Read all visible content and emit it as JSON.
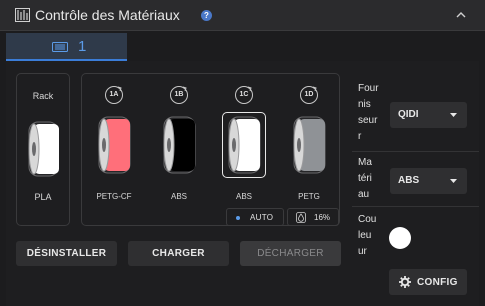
{
  "header": {
    "title": "Contrôle des Matériaux",
    "help_icon": "question-circle-icon",
    "collapse_icon": "chevron-up-icon"
  },
  "unit_tab": {
    "number": "1",
    "icon": "filament-unit-icon"
  },
  "rack": {
    "label": "Rack",
    "material": "PLA",
    "spool_color": "#ffffff"
  },
  "slots": [
    {
      "id": "1A",
      "material": "PETG-CF",
      "spool_color": "#ff6f7a",
      "selected": false
    },
    {
      "id": "1B",
      "material": "ABS",
      "spool_color": "#000000",
      "selected": false
    },
    {
      "id": "1C",
      "material": "ABS",
      "spool_color": "#ffffff",
      "selected": true
    },
    {
      "id": "1D",
      "material": "PETG",
      "spool_color": "#8f9296",
      "selected": false
    }
  ],
  "status": {
    "auto_label": "AUTO",
    "humidity": "16%"
  },
  "buttons": {
    "unload": "DÉSINSTALLER",
    "load": "CHARGER",
    "eject": "DÉCHARGER"
  },
  "fields": {
    "supplier_label_lines": [
      "Four",
      "nis",
      "seur",
      "r"
    ],
    "supplier_value": "QIDI",
    "material_label_lines": [
      "Ma",
      "téri",
      "au"
    ],
    "material_value": "ABS",
    "color_label_lines": [
      "Cou",
      "leu",
      "ur"
    ],
    "color_value": "#ffffff"
  },
  "config": {
    "label": "CONFIG",
    "icon": "gear-icon"
  },
  "colors": {
    "accent": "#3b7dd8",
    "background": "#1c1c1e",
    "panel": "#2f2f31"
  }
}
